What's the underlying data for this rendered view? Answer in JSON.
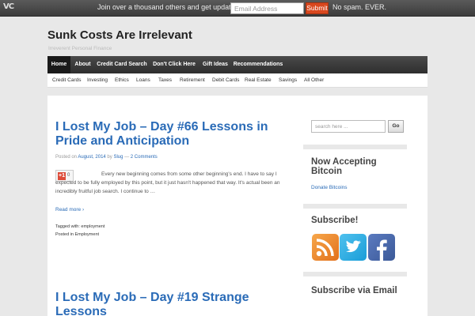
{
  "topbar": {
    "logo": "VC",
    "message": "Join over a thousand others and get updates free.",
    "email_placeholder": "Email Address",
    "submit_label": "Submit",
    "no_spam": "No spam. EVER."
  },
  "header": {
    "title": "Sunk Costs Are Irrelevant",
    "tagline": "Irreverent Personal Finance"
  },
  "main_nav": [
    "Home",
    "About",
    "Credit Card Search",
    "Don't Click Here",
    "Gift Ideas",
    "Recommendations"
  ],
  "sub_nav": [
    "Credit Cards",
    "Investing",
    "Ethics",
    "Loans",
    "Taxes",
    "Retirement",
    "Debit Cards",
    "Real Estate",
    "Savings",
    "All Other"
  ],
  "posts": [
    {
      "title": "I Lost My Job – Day #66 Lessons in Pride and Anticipation",
      "posted_on": "Posted on",
      "date": "August, 2014",
      "by": "by",
      "author": "Slug",
      "sep": "—",
      "comments": "2 Comments",
      "gplus_label": "+1",
      "gplus_count": "0",
      "excerpt": "Every new beginning comes from some other beginning's end. I have to say I expected to be fully employed by this point, but it just hasn't happened that way.  It's actual been an incredibly fruitful job search.  I continue to  …",
      "read_more": "Read more ›",
      "tagged_label": "Tagged with:",
      "tag": "employment",
      "posted_in_label": "Posted in",
      "category": "Employment"
    },
    {
      "title": "I Lost My Job – Day #19 Strange Lessons"
    }
  ],
  "sidebar": {
    "search_placeholder": "search here ...",
    "go_label": "Go",
    "bitcoin_title": "Now Accepting Bitcoin",
    "bitcoin_link": "Donate Bitcoins",
    "subscribe_title": "Subscribe!",
    "email_sub_title": "Subscribe via Email",
    "social_icons": [
      "rss-icon",
      "twitter-icon",
      "facebook-icon"
    ]
  },
  "colors": {
    "link": "#2a6bb7",
    "submit": "#d9481f"
  }
}
